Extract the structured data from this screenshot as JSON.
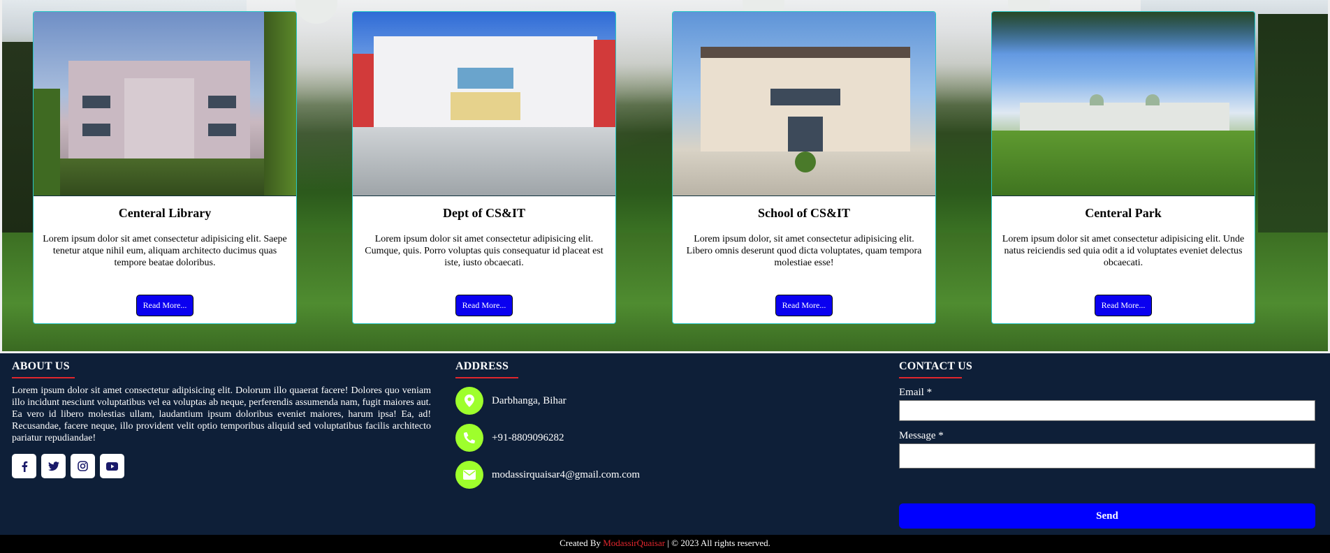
{
  "cards": [
    {
      "title": "Centeral Library",
      "text": "Lorem ipsum dolor sit amet consectetur adipisicing elit. Saepe tenetur atque nihil eum, aliquam architecto ducimus quas tempore beatae doloribus.",
      "button": "Read More..."
    },
    {
      "title": "Dept of CS&IT",
      "text": "Lorem ipsum dolor sit amet consectetur adipisicing elit. Cumque, quis. Porro voluptas quis consequatur id placeat est iste, iusto obcaecati.",
      "button": "Read More..."
    },
    {
      "title": "School of CS&IT",
      "text": "Lorem ipsum dolor, sit amet consectetur adipisicing elit. Libero omnis deserunt quod dicta voluptates, quam tempora molestiae esse!",
      "button": "Read More..."
    },
    {
      "title": "Centeral Park",
      "text": "Lorem ipsum dolor sit amet consectetur adipisicing elit. Unde natus reiciendis sed quia odit a id voluptates eveniet delectus obcaecati.",
      "button": "Read More..."
    }
  ],
  "footer": {
    "about": {
      "heading": "ABOUT US",
      "text": "Lorem ipsum dolor sit amet consectetur adipisicing elit. Dolorum illo quaerat facere! Dolores quo veniam illo incidunt nesciunt voluptatibus vel ea voluptas ab neque, perferendis assumenda nam, fugit maiores aut. Ea vero id libero molestias ullam, laudantium ipsum doloribus eveniet maiores, harum ipsa! Ea, ad! Recusandae, facere neque, illo provident velit optio temporibus aliquid sed voluptatibus facilis architecto pariatur repudiandae!",
      "socials": [
        "facebook-icon",
        "twitter-icon",
        "instagram-icon",
        "youtube-icon"
      ]
    },
    "address": {
      "heading": "ADDRESS",
      "location": "Darbhanga, Bihar",
      "phone": "+91-8809096282",
      "email": "modassirquaisar4@gmail.com.com"
    },
    "contact": {
      "heading": "CONTACT US",
      "email_label": "Email",
      "message_label": "Message",
      "required_mark": "*",
      "send_label": "Send"
    }
  },
  "bottom_bar": {
    "prefix": "Created By",
    "author": "ModassirQuaisar",
    "separator": "|",
    "copyright_symbol": "©",
    "suffix": "2023 All rights reserved."
  },
  "colors": {
    "accent_red": "#e0262d",
    "button_blue": "#0a00f0",
    "footer_bg": "#0e1f38",
    "icon_green": "#9eff2c",
    "card_border": "#26c6c6"
  }
}
